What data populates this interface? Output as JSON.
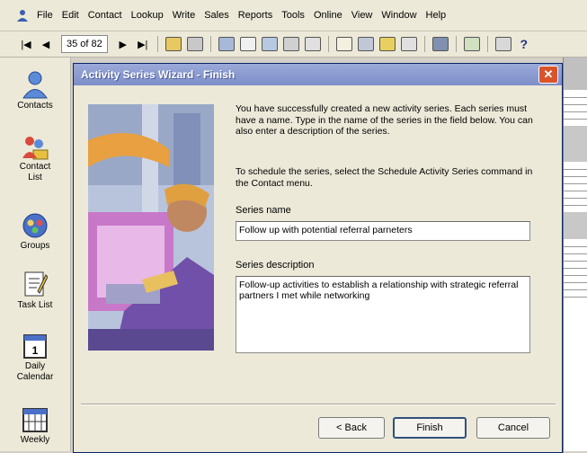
{
  "menu": [
    "File",
    "Edit",
    "Contact",
    "Lookup",
    "Write",
    "Sales",
    "Reports",
    "Tools",
    "Online",
    "View",
    "Window",
    "Help"
  ],
  "toolbar": {
    "record_position": "35 of 82"
  },
  "sidebar": [
    {
      "label": "Contacts",
      "icon": "contacts-icon"
    },
    {
      "label": "Contact List",
      "icon": "contact-list-icon"
    },
    {
      "label": "Groups",
      "icon": "groups-icon"
    },
    {
      "label": "Task List",
      "icon": "task-list-icon"
    },
    {
      "label": "Daily Calendar",
      "icon": "daily-calendar-icon"
    },
    {
      "label": "Weekly",
      "icon": "weekly-calendar-icon"
    }
  ],
  "dialog": {
    "title": "Activity Series Wizard - Finish",
    "intro": "You have successfully created a new activity series. Each series must have a name. Type in the name of the series in the field below. You can also enter a description of the series.",
    "schedule_note": "To schedule the series, select the Schedule Activity Series command in the Contact menu.",
    "series_name_label": "Series name",
    "series_name_value": "Follow up with potential referral parneters",
    "series_desc_label": "Series description",
    "series_desc_value": "Follow-up activities to establish a relationship with strategic referral partners I met while networking",
    "back_label": "< Back",
    "finish_label": "Finish",
    "cancel_label": "Cancel"
  }
}
